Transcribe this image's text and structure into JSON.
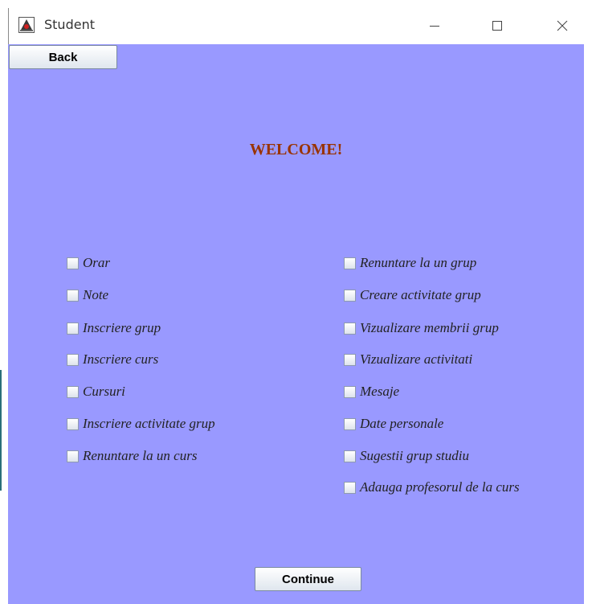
{
  "window": {
    "title": "Student",
    "icon": "java-duke-icon"
  },
  "buttons": {
    "back": "Back",
    "continue": "Continue"
  },
  "welcome": "WELCOME!",
  "left_options": [
    "Orar",
    "Note",
    "Inscriere grup",
    "Inscriere curs",
    "Cursuri",
    "Inscriere activitate grup",
    "Renuntare la un curs"
  ],
  "right_options": [
    "Renuntare la un grup",
    "Creare activitate grup",
    "Vizualizare membrii grup",
    "Vizualizare activitati",
    "Mesaje",
    "Date personale",
    "Sugestii grup studiu",
    "Adauga profesorul de la curs"
  ],
  "colors": {
    "background": "#9999ff",
    "welcome": "#993300"
  }
}
